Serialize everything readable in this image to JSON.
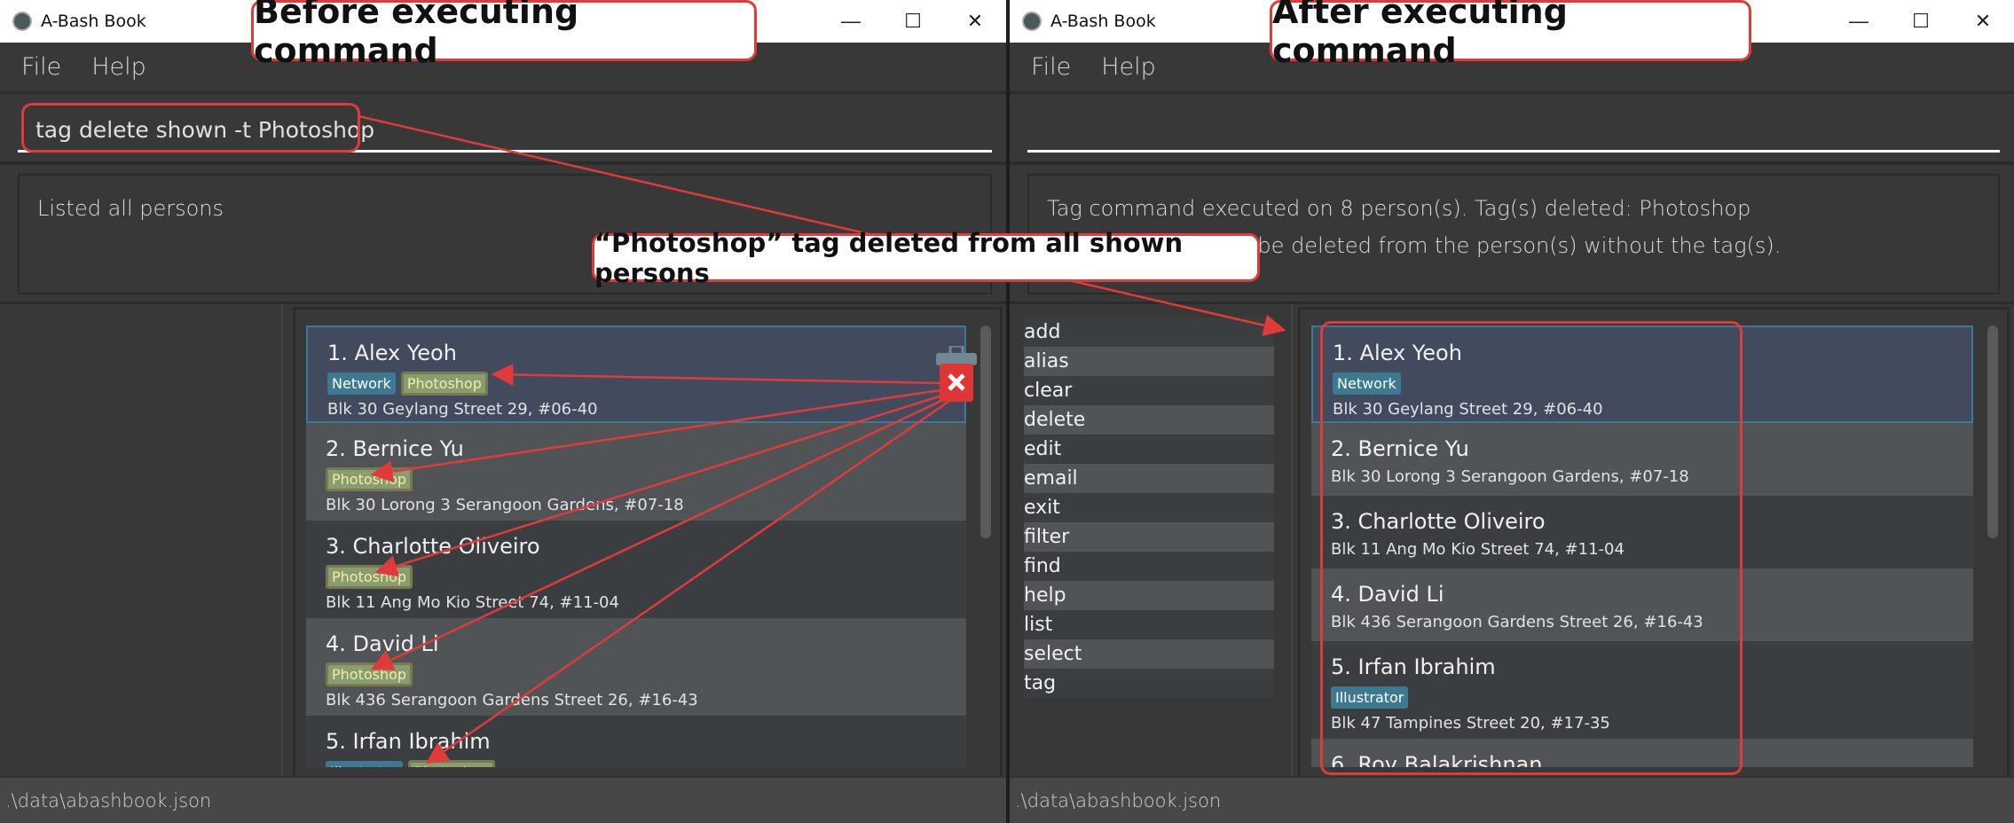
{
  "before": {
    "window_title": "A-Bash Book",
    "menu": [
      "File",
      "Help"
    ],
    "command_input": "tag delete shown -t Photoshop",
    "result_lines": [
      "Listed all persons"
    ],
    "persons": [
      {
        "index": "1.",
        "name": "Alex Yeoh",
        "tags": [
          {
            "label": "Network",
            "type": "blue"
          },
          {
            "label": "Photoshop",
            "type": "ps"
          }
        ],
        "address": "Blk 30 Geylang Street 29, #06-40",
        "selected": true
      },
      {
        "index": "2.",
        "name": "Bernice Yu",
        "tags": [
          {
            "label": "Photoshop",
            "type": "ps"
          }
        ],
        "address": "Blk 30 Lorong 3 Serangoon Gardens, #07-18"
      },
      {
        "index": "3.",
        "name": "Charlotte Oliveiro",
        "tags": [
          {
            "label": "Photoshop",
            "type": "ps"
          }
        ],
        "address": "Blk 11 Ang Mo Kio Street 74, #11-04"
      },
      {
        "index": "4.",
        "name": "David Li",
        "tags": [
          {
            "label": "Photoshop",
            "type": "ps"
          }
        ],
        "address": "Blk 436 Serangoon Gardens Street 26, #16-43"
      },
      {
        "index": "5.",
        "name": "Irfan Ibrahim",
        "tags": [
          {
            "label": "Illustrator",
            "type": "blue"
          },
          {
            "label": "Photoshop",
            "type": "ps"
          }
        ],
        "address": ""
      }
    ],
    "status_path": ".\\data\\abashbook.json"
  },
  "after": {
    "window_title": "A-Bash Book",
    "menu": [
      "File",
      "Help"
    ],
    "command_input": "",
    "result_lines": [
      "Tag command executed on 8 person(s). Tag(s) deleted: Photoshop",
      "Note: No tag(s) will be deleted from the person(s) without the tag(s)."
    ],
    "commands": [
      "add",
      "alias",
      "clear",
      "delete",
      "edit",
      "email",
      "exit",
      "filter",
      "find",
      "help",
      "list",
      "select",
      "tag"
    ],
    "persons": [
      {
        "index": "1.",
        "name": "Alex Yeoh",
        "tags": [
          {
            "label": "Network",
            "type": "blue"
          }
        ],
        "address": "Blk 30 Geylang Street 29, #06-40",
        "selected": true
      },
      {
        "index": "2.",
        "name": "Bernice Yu",
        "tags": [],
        "address": "Blk 30 Lorong 3 Serangoon Gardens, #07-18"
      },
      {
        "index": "3.",
        "name": "Charlotte Oliveiro",
        "tags": [],
        "address": "Blk 11 Ang Mo Kio Street 74, #11-04"
      },
      {
        "index": "4.",
        "name": "David Li",
        "tags": [],
        "address": "Blk 436 Serangoon Gardens Street 26, #16-43"
      },
      {
        "index": "5.",
        "name": "Irfan Ibrahim",
        "tags": [
          {
            "label": "Illustrator",
            "type": "blue"
          }
        ],
        "address": "Blk 47 Tampines Street 20, #17-35"
      },
      {
        "index": "6.",
        "name": "Roy Balakrishnan",
        "tags": [],
        "address": ""
      }
    ],
    "status_path": ".\\data\\abashbook.json"
  },
  "annotations": {
    "before_label": "Before executing command",
    "after_label": "After executing command",
    "center_label": "“Photoshop” tag deleted from all shown persons",
    "accent_color": "#e03b3b"
  },
  "window_controls": {
    "minimize": "—",
    "maximize": "☐",
    "close": "✕"
  }
}
